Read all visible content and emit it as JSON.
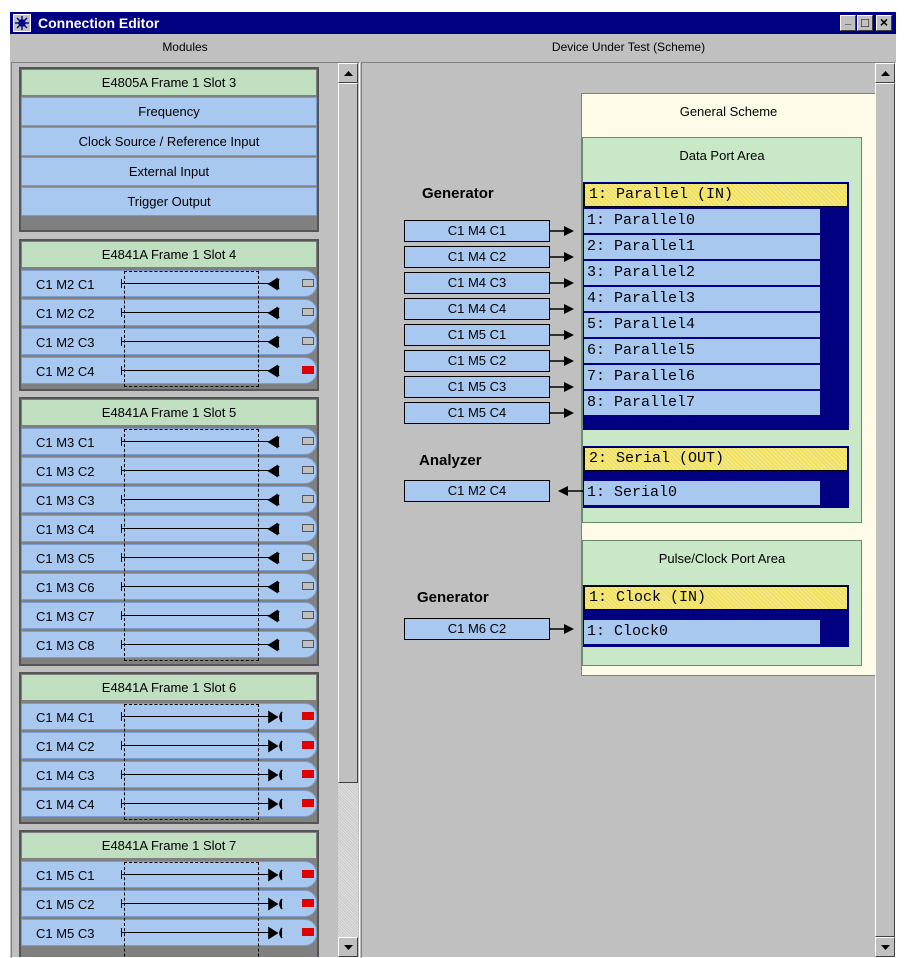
{
  "window": {
    "title": "Connection Editor",
    "minimize": "_",
    "maximize": "□",
    "close": "×"
  },
  "panes": {
    "modules_header": "Modules",
    "dut_header": "Device Under Test (Scheme)"
  },
  "modules": [
    {
      "title": "E4805A   Frame 1   Slot 3",
      "items": [
        "Frequency",
        "Clock Source / Reference Input",
        "External Input",
        "Trigger Output"
      ]
    },
    {
      "title": "E4841A   Frame 1   Slot 4",
      "channels": [
        {
          "label": "C1 M2 C1",
          "direction": "in",
          "active": false
        },
        {
          "label": "C1 M2 C2",
          "direction": "in",
          "active": false
        },
        {
          "label": "C1 M2 C3",
          "direction": "in",
          "active": false
        },
        {
          "label": "C1 M2 C4",
          "direction": "in",
          "active": true
        }
      ]
    },
    {
      "title": "E4841A   Frame 1   Slot 5",
      "channels": [
        {
          "label": "C1 M3 C1",
          "direction": "in",
          "active": false
        },
        {
          "label": "C1 M3 C2",
          "direction": "in",
          "active": false
        },
        {
          "label": "C1 M3 C3",
          "direction": "in",
          "active": false
        },
        {
          "label": "C1 M3 C4",
          "direction": "in",
          "active": false
        },
        {
          "label": "C1 M3 C5",
          "direction": "in",
          "active": false
        },
        {
          "label": "C1 M3 C6",
          "direction": "in",
          "active": false
        },
        {
          "label": "C1 M3 C7",
          "direction": "in",
          "active": false
        },
        {
          "label": "C1 M3 C8",
          "direction": "in",
          "active": false
        }
      ]
    },
    {
      "title": "E4841A   Frame 1   Slot 6",
      "channels": [
        {
          "label": "C1 M4 C1",
          "direction": "out",
          "active": true
        },
        {
          "label": "C1 M4 C2",
          "direction": "out",
          "active": true
        },
        {
          "label": "C1 M4 C3",
          "direction": "out",
          "active": true
        },
        {
          "label": "C1 M4 C4",
          "direction": "out",
          "active": true
        }
      ]
    },
    {
      "title": "E4841A   Frame 1   Slot 7",
      "channels": [
        {
          "label": "C1 M5 C1",
          "direction": "out",
          "active": true
        },
        {
          "label": "C1 M5 C2",
          "direction": "out",
          "active": true
        },
        {
          "label": "C1 M5 C3",
          "direction": "out",
          "active": true
        }
      ]
    }
  ],
  "scheme": {
    "title": "General Scheme",
    "data_area": {
      "title": "Data Port Area",
      "generator_label": "Generator",
      "analyzer_label": "Analyzer",
      "parallel": {
        "header": "1: Parallel (IN)",
        "links": [
          {
            "channel": "C1 M4 C1",
            "port": "1: Parallel0"
          },
          {
            "channel": "C1 M4 C2",
            "port": "2: Parallel1"
          },
          {
            "channel": "C1 M4 C3",
            "port": "3: Parallel2"
          },
          {
            "channel": "C1 M4 C4",
            "port": "4: Parallel3"
          },
          {
            "channel": "C1 M5 C1",
            "port": "5: Parallel4"
          },
          {
            "channel": "C1 M5 C2",
            "port": "6: Parallel5"
          },
          {
            "channel": "C1 M5 C3",
            "port": "7: Parallel6"
          },
          {
            "channel": "C1 M5 C4",
            "port": "8: Parallel7"
          }
        ]
      },
      "serial": {
        "header": "2: Serial (OUT)",
        "links": [
          {
            "channel": "C1 M2 C4",
            "port": "1: Serial0"
          }
        ]
      }
    },
    "clock_area": {
      "title": "Pulse/Clock Port Area",
      "generator_label": "Generator",
      "clock": {
        "header": "1: Clock (IN)",
        "links": [
          {
            "channel": "C1 M6 C2",
            "port": "1: Clock0"
          }
        ]
      }
    }
  },
  "colors": {
    "title_bar": "#000080",
    "module_header": "#c0dec0",
    "channel": "#a8c8f0",
    "port_header": "#f0e060",
    "active_connector": "#e00000"
  },
  "icons": [
    "app-icon",
    "minimize-icon",
    "maximize-icon",
    "close-icon",
    "scroll-up-icon",
    "scroll-down-icon",
    "arrow-right-icon",
    "arrow-left-icon"
  ]
}
